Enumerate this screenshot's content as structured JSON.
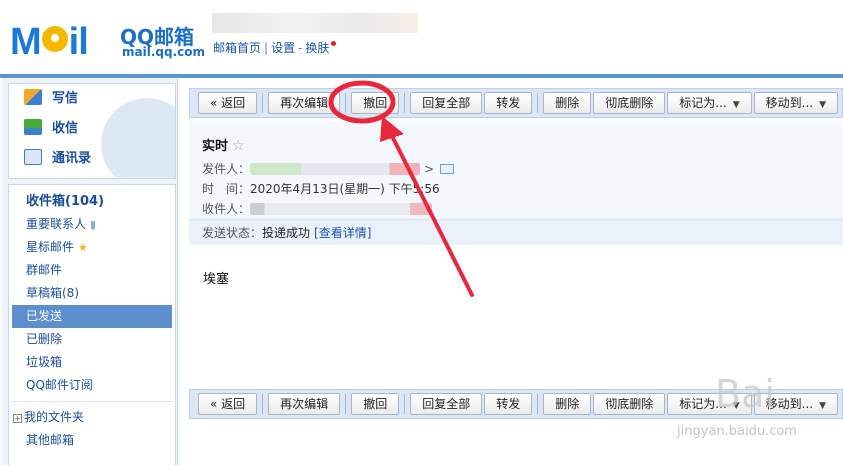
{
  "header": {
    "logo_text": "M  il",
    "brand": "QQ邮箱",
    "domain": "mail.qq.com",
    "nav": [
      "邮箱首页",
      "设置",
      "换肤"
    ]
  },
  "sidebar": {
    "quick": [
      {
        "label": "写信",
        "icon": "write-icon"
      },
      {
        "label": "收信",
        "icon": "inbox-icon"
      },
      {
        "label": "通讯录",
        "icon": "contacts-icon"
      }
    ],
    "folders": [
      {
        "label": "收件箱(104)"
      },
      {
        "label": "重要联系人"
      },
      {
        "label": "星标邮件"
      },
      {
        "label": "群邮件"
      },
      {
        "label": "草稿箱(8)"
      },
      {
        "label": "已发送"
      },
      {
        "label": "已删除"
      },
      {
        "label": "垃圾箱"
      },
      {
        "label": "QQ邮件订阅"
      },
      {
        "label": "我的文件夹"
      },
      {
        "label": "其他邮箱"
      }
    ],
    "tree_toggle": "+"
  },
  "toolbar": {
    "back": "« 返回",
    "reedit": "再次编辑",
    "recall": "撤回",
    "reply_all": "回复全部",
    "forward": "转发",
    "delete": "删除",
    "perm_delete": "彻底删除",
    "mark_as": "标记为...",
    "move_to": "移动到...",
    "caret": "▼"
  },
  "mail": {
    "subject": "实时",
    "star": "☆",
    "from_label": "发件人：",
    "from_suffix": ">",
    "time_label": "时　间：",
    "time_value": "2020年4月13日(星期一) 下午5:56",
    "to_label": "收件人：",
    "status_label": "发送状态：",
    "status_value": "投递成功",
    "status_link": "[查看详情]",
    "body": "埃塞"
  },
  "watermark": {
    "site": "jingyan.baidu.com",
    "paw": "Bai"
  },
  "colors": {
    "accent": "#5d95cf",
    "annotation": "#e8283a",
    "link": "#1b56a8"
  }
}
